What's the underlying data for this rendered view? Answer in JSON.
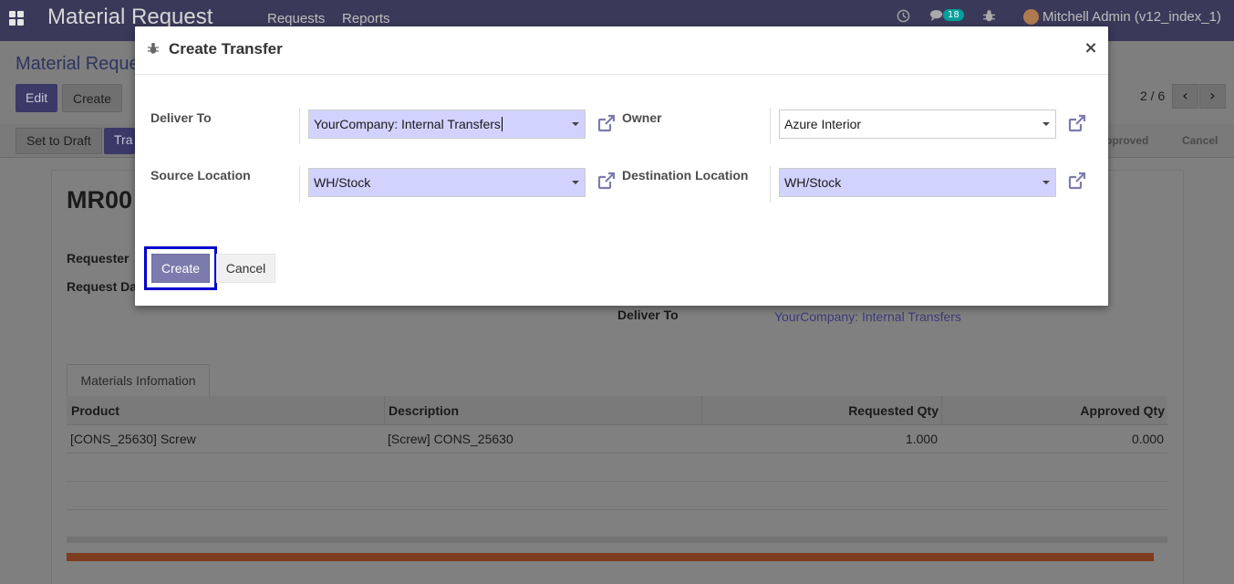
{
  "navbar": {
    "brand": "Material Request",
    "menu": [
      "Requests",
      "Reports"
    ],
    "messages_count": "18",
    "user": "Mitchell Admin (v12_index_1)"
  },
  "control_panel": {
    "breadcrumb": "Material Reque",
    "edit_label": "Edit",
    "create_label": "Create",
    "pager": "2 / 6",
    "set_to_draft_label": "Set to Draft",
    "transfer_label": "Tra",
    "stages": [
      "pproved",
      "Cancel"
    ]
  },
  "record": {
    "name": "MR00",
    "requester_label": "Requester",
    "request_date_label": "Request Da",
    "deliver_to_label": "Deliver To",
    "deliver_to_value": "YourCompany: Internal Transfers",
    "tab_label": "Materials Infomation",
    "table": {
      "headers": [
        "Product",
        "Description",
        "Requested Qty",
        "Approved Qty"
      ],
      "rows": [
        [
          "[CONS_25630] Screw",
          "[Screw] CONS_25630",
          "1.000",
          "0.000"
        ]
      ]
    }
  },
  "modal": {
    "title": "Create Transfer",
    "fields": {
      "deliver_to": {
        "label": "Deliver To",
        "value": "YourCompany: Internal Transfers"
      },
      "owner": {
        "label": "Owner",
        "value": "Azure Interior"
      },
      "source_location": {
        "label": "Source Location",
        "value": "WH/Stock"
      },
      "destination_location": {
        "label": "Destination Location",
        "value": "WH/Stock"
      }
    },
    "create_label": "Create",
    "cancel_label": "Cancel",
    "close_label": "×"
  },
  "colors": {
    "navbar": "#3b3959",
    "required_field": "#d2d2ff",
    "primary_button": "#7c7bad",
    "highlight_border": "#0000cc"
  }
}
